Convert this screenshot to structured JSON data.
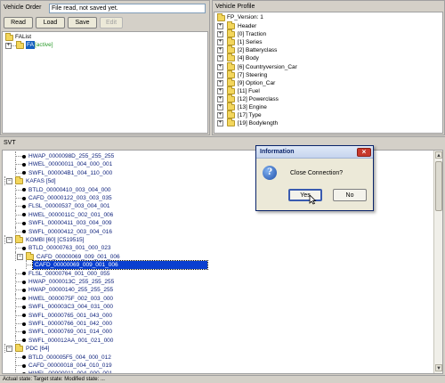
{
  "vehicle_order": {
    "title": "Vehicle Order",
    "status_value": "File read, not saved yet.",
    "buttons": {
      "read": "Read",
      "load": "Load",
      "save": "Save",
      "edit": "Edit"
    },
    "fa_list": {
      "root": "FAList",
      "child_name": "FA",
      "child_status": "[active]"
    }
  },
  "vehicle_profile": {
    "title": "Vehicle Profile",
    "root": "FP_Version: 1",
    "items": [
      "Header",
      "[0] Traction",
      "[1] Series",
      "[2] Batteryclass",
      "[4] Body",
      "[6] Countryversion_Car",
      "[7] Steering",
      "[9] Option_Car",
      "[11] Fuel",
      "[12] Powerclass",
      "[13] Engine",
      "[17] Type",
      "[19] Bodylength"
    ]
  },
  "svt": {
    "title": "SVT",
    "rows": [
      {
        "kind": "leaf",
        "indent": 2,
        "text": "HWAP_0000098D_255_255_255"
      },
      {
        "kind": "leaf",
        "indent": 2,
        "text": "HWEL_00000011_004_000_001"
      },
      {
        "kind": "leaf",
        "indent": 2,
        "text": "SWFL_000004B1_004_110_000"
      },
      {
        "kind": "folder",
        "indent": 1,
        "text": "KAFAS [5d]"
      },
      {
        "kind": "leaf",
        "indent": 2,
        "text": "BTLD_00000410_003_004_000"
      },
      {
        "kind": "leaf",
        "indent": 2,
        "text": "CAFD_00000122_003_003_035"
      },
      {
        "kind": "leaf",
        "indent": 2,
        "text": "FLSL_00000537_003_004_001"
      },
      {
        "kind": "leaf",
        "indent": 2,
        "text": "HWEL_0000011C_002_001_006"
      },
      {
        "kind": "leaf",
        "indent": 2,
        "text": "SWFL_00000411_003_004_009"
      },
      {
        "kind": "leaf",
        "indent": 2,
        "text": "SWFL_00000412_003_004_016"
      },
      {
        "kind": "folder",
        "indent": 1,
        "text": "KOMBI [60] [C519515]"
      },
      {
        "kind": "leaf",
        "indent": 2,
        "text": "BTLD_00000763_001_000_023"
      },
      {
        "kind": "folder",
        "indent": 2,
        "text": "CAFD_00000069_009_001_006"
      },
      {
        "kind": "selected",
        "indent": 3,
        "text": "CAFD_00000069_009_001_006"
      },
      {
        "kind": "leaf",
        "indent": 2,
        "text": "FLSL_00000764_001_000_055"
      },
      {
        "kind": "leaf",
        "indent": 2,
        "text": "HWAP_0000013C_255_255_255"
      },
      {
        "kind": "leaf",
        "indent": 2,
        "text": "HWAP_00000140_255_255_255"
      },
      {
        "kind": "leaf",
        "indent": 2,
        "text": "HWEL_0000075F_002_003_000"
      },
      {
        "kind": "leaf",
        "indent": 2,
        "text": "SWFL_000003C3_004_031_000"
      },
      {
        "kind": "leaf",
        "indent": 2,
        "text": "SWFL_00000765_001_043_000"
      },
      {
        "kind": "leaf",
        "indent": 2,
        "text": "SWFL_00000766_001_042_000"
      },
      {
        "kind": "leaf",
        "indent": 2,
        "text": "SWFL_00000769_001_014_000"
      },
      {
        "kind": "leaf",
        "indent": 2,
        "text": "SWFL_000012AA_001_021_000"
      },
      {
        "kind": "folder",
        "indent": 1,
        "text": "PDC [64]"
      },
      {
        "kind": "leaf",
        "indent": 2,
        "text": "BTLD_000005F5_004_000_012"
      },
      {
        "kind": "leaf",
        "indent": 2,
        "text": "CAFD_00000018_004_010_019"
      },
      {
        "kind": "leaf",
        "indent": 2,
        "text": "HWEL_00000011_004_000_001"
      }
    ]
  },
  "dialog": {
    "title": "Information",
    "message": "Close Connection?",
    "yes": "Yes",
    "no": "No",
    "icon": "question-icon"
  },
  "status_bar": "Actual state:   Target state:   Modified state:   ..."
}
